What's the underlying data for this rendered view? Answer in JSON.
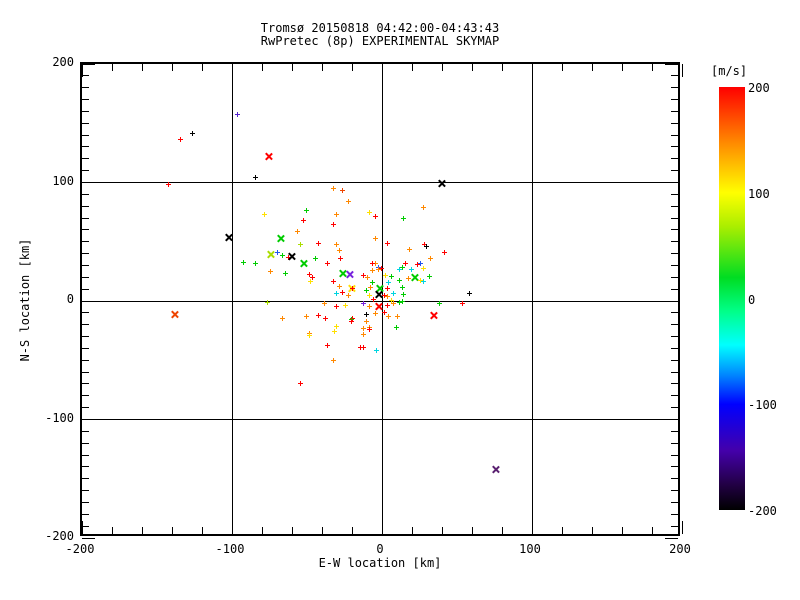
{
  "title": {
    "line1": "Tromsø 20150818 04:42:00-04:43:43",
    "line2": "RwPretec (8p) EXPERIMENTAL SKYMAP"
  },
  "plot": {
    "xlabel": "E-W location [km]",
    "ylabel": "N-S location [km]",
    "x_tick_labels": [
      "-200",
      "-100",
      "0",
      "100",
      "200"
    ],
    "y_tick_labels": [
      "200",
      "100",
      "0",
      "-100",
      "-200"
    ]
  },
  "colorbar": {
    "title": "[m/s]",
    "tick_labels": [
      "200",
      "100",
      "0",
      "-100",
      "-200"
    ]
  },
  "chart_data": {
    "type": "scatter",
    "title": "Tromsø 20150818 04:42:00-04:43:43",
    "subtitle": "RwPretec (8p) EXPERIMENTAL SKYMAP",
    "xlabel": "E-W location [km]",
    "ylabel": "N-S location [km]",
    "xlim": [
      -200,
      200
    ],
    "ylim": [
      -200,
      200
    ],
    "x_major_ticks": [
      -200,
      -100,
      0,
      100,
      200
    ],
    "y_major_ticks": [
      -200,
      -100,
      0,
      100,
      200
    ],
    "x_minor_step": 20,
    "y_minor_step": 10,
    "grid_lines_at": [
      -100,
      0,
      100
    ],
    "grid": true,
    "colorbar": {
      "label": "[m/s]",
      "min": -200,
      "max": 200,
      "ticks": [
        200,
        100,
        0,
        -100,
        -200
      ],
      "gradient_stops": [
        [
          "#ff0000",
          0
        ],
        [
          "#ff8800",
          0.13
        ],
        [
          "#ffff00",
          0.25
        ],
        [
          "#aaee00",
          0.33
        ],
        [
          "#00dd22",
          0.45
        ],
        [
          "#00ff88",
          0.53
        ],
        [
          "#00ffff",
          0.61
        ],
        [
          "#0088ff",
          0.68
        ],
        [
          "#0000ff",
          0.75
        ],
        [
          "#4400aa",
          0.86
        ],
        [
          "#220044",
          0.94
        ],
        [
          "#000000",
          1
        ]
      ]
    },
    "marker_colors": {
      "red": "#ff0000",
      "orangered": "#ee4400",
      "orange": "#ff8800",
      "yellow": "#ffe000",
      "chartreuse": "#aadd00",
      "green": "#00cc00",
      "cyan": "#00d5e0",
      "blue": "#2255ee",
      "violet": "#7722dd",
      "indigo": "#5522cc",
      "darkviolet": "#5a2070",
      "black": "#000000"
    },
    "marker_legend": {
      "s": "small plus (echo point)",
      "x": "large cross (echo point)"
    },
    "points": [
      [
        -127,
        142,
        "black",
        "s"
      ],
      [
        -135,
        137,
        "red",
        "s"
      ],
      [
        -97,
        158,
        "indigo",
        "s"
      ],
      [
        -85,
        105,
        "black",
        "s"
      ],
      [
        -143,
        99,
        "red",
        "s"
      ],
      [
        -27,
        94,
        "orangered",
        "s"
      ],
      [
        -76,
        122,
        "red",
        "x"
      ],
      [
        -103,
        54,
        "black",
        "x"
      ],
      [
        39,
        100,
        "black",
        "x"
      ],
      [
        -139,
        -11,
        "orangered",
        "x"
      ],
      [
        75,
        -142,
        "darkviolet",
        "x"
      ],
      [
        34,
        -12,
        "red",
        "x"
      ],
      [
        58,
        7,
        "black",
        "s"
      ],
      [
        -33,
        95,
        "orange",
        "s"
      ],
      [
        -23,
        84,
        "orange",
        "s"
      ],
      [
        -51,
        77,
        "green",
        "s"
      ],
      [
        -31,
        73,
        "orange",
        "s"
      ],
      [
        -79,
        73,
        "yellow",
        "s"
      ],
      [
        -53,
        68,
        "red",
        "s"
      ],
      [
        -33,
        65,
        "red",
        "s"
      ],
      [
        -57,
        59,
        "orange",
        "s"
      ],
      [
        -68,
        53,
        "green",
        "x"
      ],
      [
        -43,
        49,
        "red",
        "s"
      ],
      [
        -55,
        48,
        "chartreuse",
        "s"
      ],
      [
        -31,
        48,
        "orange",
        "s"
      ],
      [
        -70,
        41,
        "blue",
        "s"
      ],
      [
        -75,
        40,
        "chartreuse",
        "x"
      ],
      [
        -67,
        39,
        "green",
        "s"
      ],
      [
        -63,
        37,
        "red",
        "s"
      ],
      [
        -61,
        38,
        "black",
        "x"
      ],
      [
        -29,
        43,
        "orange",
        "s"
      ],
      [
        -28,
        36,
        "red",
        "s"
      ],
      [
        -93,
        33,
        "green",
        "s"
      ],
      [
        -53,
        32,
        "green",
        "x"
      ],
      [
        -45,
        36,
        "green",
        "s"
      ],
      [
        -37,
        32,
        "red",
        "s"
      ],
      [
        -85,
        32,
        "green",
        "s"
      ],
      [
        -75,
        25,
        "orange",
        "s"
      ],
      [
        -49,
        23,
        "red",
        "s"
      ],
      [
        -47,
        20,
        "red",
        "s"
      ],
      [
        -65,
        24,
        "green",
        "s"
      ],
      [
        -48,
        17,
        "yellow",
        "s"
      ],
      [
        -27,
        24,
        "green",
        "x"
      ],
      [
        -22,
        23,
        "violet",
        "x"
      ],
      [
        -33,
        17,
        "red",
        "s"
      ],
      [
        -29,
        13,
        "orange",
        "s"
      ],
      [
        -21,
        11,
        "yellow",
        "x"
      ],
      [
        -31,
        7,
        "cyan",
        "s"
      ],
      [
        -27,
        8,
        "red",
        "s"
      ],
      [
        -23,
        5,
        "orange",
        "s"
      ],
      [
        -20,
        11,
        "red",
        "s"
      ],
      [
        -77,
        -1,
        "chartreuse",
        "s"
      ],
      [
        -9,
        75,
        "yellow",
        "s"
      ],
      [
        -5,
        72,
        "red",
        "s"
      ],
      [
        14,
        70,
        "green",
        "s"
      ],
      [
        27,
        79,
        "orange",
        "s"
      ],
      [
        -5,
        53,
        "orange",
        "s"
      ],
      [
        3,
        49,
        "red",
        "s"
      ],
      [
        18,
        44,
        "orange",
        "s"
      ],
      [
        28,
        48,
        "red",
        "s"
      ],
      [
        29,
        46,
        "black",
        "s"
      ],
      [
        41,
        41,
        "red",
        "s"
      ],
      [
        32,
        36,
        "orange",
        "s"
      ],
      [
        25,
        32,
        "blue",
        "s"
      ],
      [
        15,
        32,
        "red",
        "s"
      ],
      [
        13,
        29,
        "green",
        "s"
      ],
      [
        11,
        27,
        "cyan",
        "s"
      ],
      [
        -5,
        32,
        "orange",
        "s"
      ],
      [
        -3,
        29,
        "blue",
        "s"
      ],
      [
        -7,
        26,
        "orange",
        "s"
      ],
      [
        -1,
        28,
        "red",
        "s"
      ],
      [
        -13,
        22,
        "red",
        "s"
      ],
      [
        -10,
        20,
        "orange",
        "s"
      ],
      [
        6,
        21,
        "green",
        "s"
      ],
      [
        11,
        18,
        "green",
        "s"
      ],
      [
        17,
        19,
        "orange",
        "s"
      ],
      [
        21,
        20,
        "green",
        "x"
      ],
      [
        25,
        18,
        "yellow",
        "s"
      ],
      [
        27,
        28,
        "yellow",
        "s"
      ],
      [
        13,
        12,
        "green",
        "s"
      ],
      [
        3,
        11,
        "red",
        "s"
      ],
      [
        -2,
        11,
        "green",
        "x"
      ],
      [
        -8,
        12,
        "orange",
        "s"
      ],
      [
        -11,
        9,
        "green",
        "s"
      ],
      [
        -3,
        6,
        "black",
        "x"
      ],
      [
        1,
        5,
        "red",
        "s"
      ],
      [
        7,
        7,
        "cyan",
        "s"
      ],
      [
        14,
        6,
        "green",
        "s"
      ],
      [
        6,
        1,
        "yellow",
        "s"
      ],
      [
        13,
        0,
        "green",
        "s"
      ],
      [
        31,
        21,
        "green",
        "s"
      ],
      [
        27,
        17,
        "cyan",
        "s"
      ],
      [
        -3,
        27,
        "orange",
        "s"
      ],
      [
        2,
        22,
        "yellow",
        "s"
      ],
      [
        4,
        16,
        "cyan",
        "s"
      ],
      [
        -7,
        16,
        "green",
        "s"
      ],
      [
        -9,
        5,
        "yellow",
        "s"
      ],
      [
        -6,
        2,
        "red",
        "s"
      ],
      [
        3,
        4,
        "orange",
        "s"
      ],
      [
        19,
        27,
        "cyan",
        "s"
      ],
      [
        23,
        31,
        "red",
        "s"
      ],
      [
        -7,
        32,
        "red",
        "s"
      ],
      [
        -13,
        -2,
        "violet",
        "s"
      ],
      [
        -9,
        -4,
        "orange",
        "s"
      ],
      [
        -3,
        -4,
        "red",
        "x"
      ],
      [
        3,
        -3,
        "red",
        "s"
      ],
      [
        7,
        -2,
        "orange",
        "s"
      ],
      [
        11,
        -1,
        "green",
        "s"
      ],
      [
        38,
        -2,
        "green",
        "s"
      ],
      [
        53,
        -2,
        "red",
        "s"
      ],
      [
        -11,
        -11,
        "black",
        "s"
      ],
      [
        -5,
        -10,
        "orange",
        "s"
      ],
      [
        1,
        -9,
        "red",
        "s"
      ],
      [
        4,
        -13,
        "orange",
        "s"
      ],
      [
        10,
        -13,
        "orange",
        "s"
      ],
      [
        -11,
        -17,
        "orange",
        "s"
      ],
      [
        -9,
        -22,
        "orange",
        "s"
      ],
      [
        9,
        -22,
        "green",
        "s"
      ],
      [
        -13,
        -28,
        "orange",
        "s"
      ],
      [
        -13,
        -39,
        "red",
        "s"
      ],
      [
        -4,
        -41,
        "cyan",
        "s"
      ],
      [
        -39,
        -2,
        "orange",
        "s"
      ],
      [
        -31,
        -4,
        "red",
        "s"
      ],
      [
        -25,
        -3,
        "yellow",
        "s"
      ],
      [
        -67,
        -14,
        "orange",
        "s"
      ],
      [
        -51,
        -13,
        "orange",
        "s"
      ],
      [
        -43,
        -12,
        "red",
        "s"
      ],
      [
        -38,
        -14,
        "red",
        "s"
      ],
      [
        -20,
        -14,
        "red",
        "s"
      ],
      [
        -21,
        -15,
        "green",
        "s"
      ],
      [
        -31,
        -21,
        "yellow",
        "s"
      ],
      [
        -21,
        -17,
        "red",
        "s"
      ],
      [
        -49,
        -27,
        "orange",
        "s"
      ],
      [
        -49,
        -29,
        "yellow",
        "s"
      ],
      [
        -37,
        -37,
        "red",
        "s"
      ],
      [
        -15,
        -39,
        "red",
        "s"
      ],
      [
        -33,
        -50,
        "orange",
        "s"
      ],
      [
        -55,
        -69,
        "red",
        "s"
      ],
      [
        -32,
        -25,
        "yellow",
        "s"
      ],
      [
        -13,
        -23,
        "orange",
        "s"
      ],
      [
        -9,
        -24,
        "red",
        "s"
      ]
    ]
  }
}
